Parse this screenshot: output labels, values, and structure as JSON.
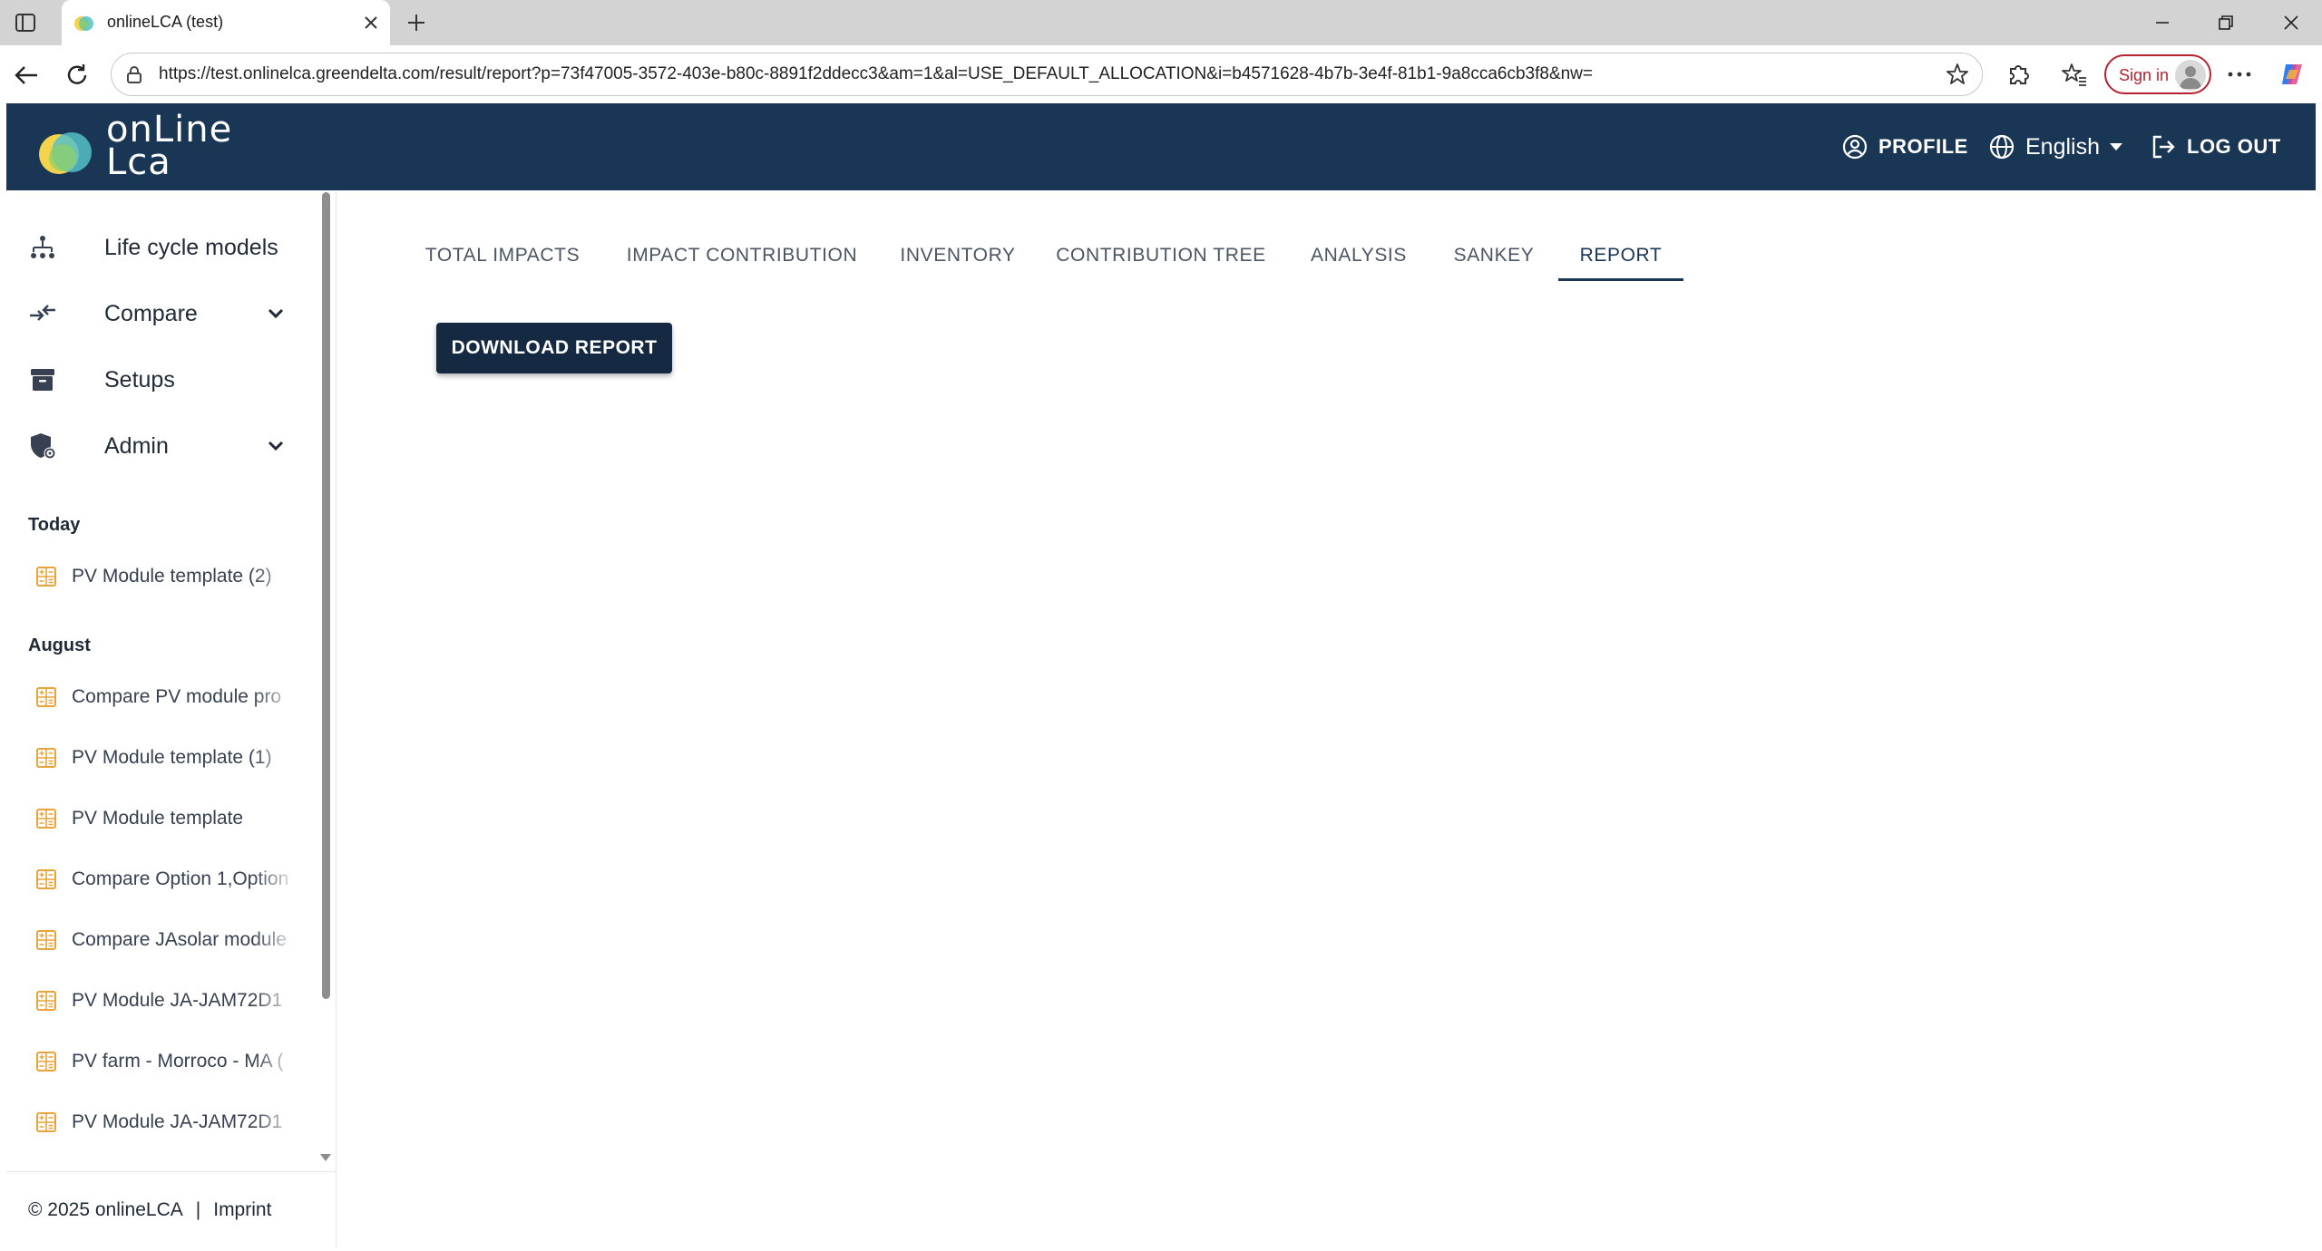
{
  "browser": {
    "tab_title": "onlineLCA (test)",
    "url": "https://test.onlinelca.greendelta.com/result/report?p=73f47005-3572-403e-b80c-8891f2ddecc3&am=1&al=USE_DEFAULT_ALLOCATION&i=b4571628-4b7b-3e4f-81b1-9a8cca6cb3f8&nw=",
    "sign_in_label": "Sign in"
  },
  "header": {
    "logo_line1": "onLine",
    "logo_line2": "Lca",
    "profile_label": "PROFILE",
    "language_label": "English",
    "logout_label": "LOG OUT"
  },
  "sidebar": {
    "nav": [
      {
        "label": "Life cycle models",
        "icon": "hierarchy-icon",
        "expandable": false
      },
      {
        "label": "Compare",
        "icon": "compare-arrows-icon",
        "expandable": true
      },
      {
        "label": "Setups",
        "icon": "archive-box-icon",
        "expandable": false
      },
      {
        "label": "Admin",
        "icon": "admin-shield-icon",
        "expandable": true
      }
    ],
    "groups": [
      {
        "label": "Today",
        "items": [
          "PV Module template (2)"
        ]
      },
      {
        "label": "August",
        "items": [
          "Compare PV module pro",
          "PV Module template (1)",
          "PV Module template",
          "Compare Option 1,Option",
          "Compare JAsolar module",
          "PV Module JA-JAM72D1",
          "PV farm - Morroco - MA (",
          "PV Module JA-JAM72D1"
        ]
      }
    ],
    "footer": {
      "copyright": "© 2025 onlineLCA",
      "separator": "|",
      "imprint": "Imprint"
    }
  },
  "main": {
    "tabs": [
      {
        "label": "TOTAL IMPACTS",
        "active": false
      },
      {
        "label": "IMPACT CONTRIBUTION",
        "active": false
      },
      {
        "label": "INVENTORY",
        "active": false
      },
      {
        "label": "CONTRIBUTION TREE",
        "active": false
      },
      {
        "label": "ANALYSIS",
        "active": false
      },
      {
        "label": "SANKEY",
        "active": false
      },
      {
        "label": "REPORT",
        "active": true
      }
    ],
    "download_label": "DOWNLOAD REPORT"
  },
  "colors": {
    "header_bg": "#1a3655",
    "accent": "#1a3655",
    "button_bg": "#152a42",
    "recent_icon": "#e8a33a",
    "signin": "#b4232f"
  }
}
